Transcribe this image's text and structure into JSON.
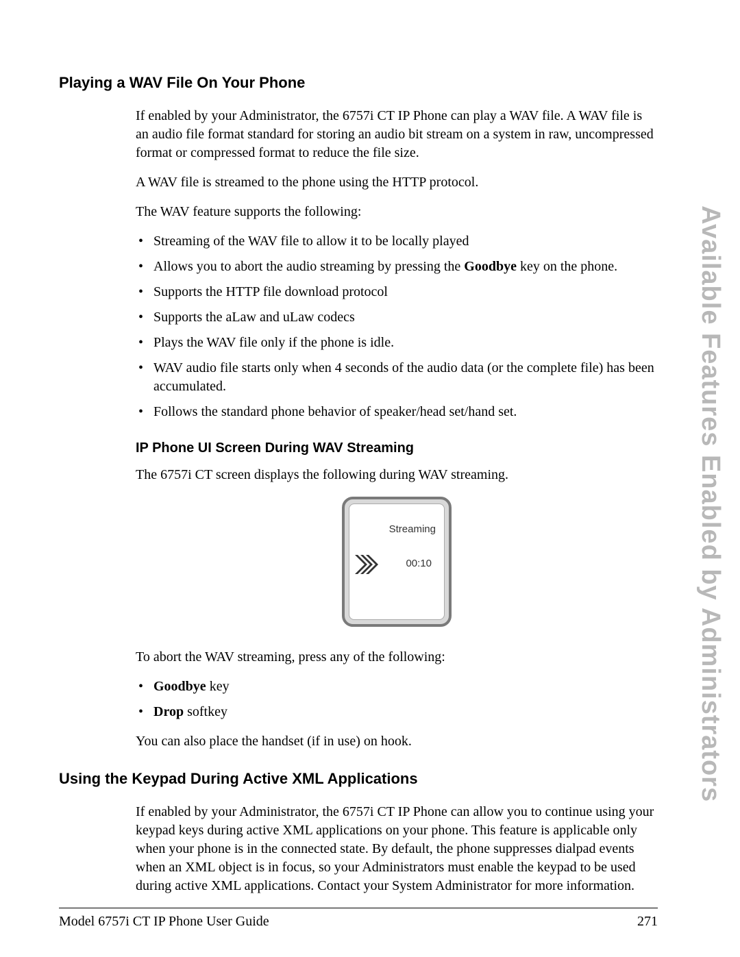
{
  "sidebar_label": "Available Features Enabled by Administrators",
  "section1": {
    "heading": "Playing a WAV File On Your Phone",
    "p1": "If enabled by your Administrator, the 6757i CT IP Phone can play a WAV file. A WAV file is an audio file format standard for storing an audio bit stream on a system in raw, uncompressed format or compressed format to reduce the file size.",
    "p2": "A WAV file is streamed to the phone using the HTTP protocol.",
    "p3": "The WAV feature supports the following:",
    "bullets": [
      "Streaming of the WAV file to allow it to be locally played",
      "Allows you to abort the audio streaming by pressing the Goodbye key on the phone.",
      "Supports the HTTP file download protocol",
      "Supports the aLaw and uLaw codecs",
      "Plays the WAV file only if the phone is idle.",
      "WAV audio file starts only when 4 seconds of the audio data (or the complete file) has been accumulated.",
      "Follows the standard phone behavior of speaker/head set/hand set."
    ],
    "sub_heading": "IP Phone UI Screen During WAV Streaming",
    "p4": "The 6757i CT screen displays the following during WAV streaming.",
    "screen": {
      "label": "Streaming",
      "time": "00:10"
    },
    "p5": "To abort the WAV streaming, press any of the following:",
    "abort_bullets_raw": [
      "Goodbye key",
      "Drop softkey"
    ],
    "abort_prefix": {
      "b1": "Goodbye",
      "b1_rest": " key",
      "b2": "Drop",
      "b2_rest": " softkey"
    },
    "p6": "You can also place the handset (if in use) on hook."
  },
  "goodbye_word": "Goodbye",
  "bullet2_part_a": "Allows you to abort the audio streaming by pressing the ",
  "bullet2_part_c": " key on the phone.",
  "section2": {
    "heading": "Using the Keypad During Active XML Applications",
    "p1": "If enabled by your Administrator, the 6757i CT IP Phone can allow you to continue using your keypad keys during active XML applications on your phone. This feature is applicable only when your phone is in the connected state. By default, the phone suppresses dialpad events when an XML object is in focus, so your Administrators must enable the keypad to be used during active XML applications. Contact your System Administrator for more information."
  },
  "footer": {
    "left": "Model 6757i CT IP Phone User Guide",
    "right": "271"
  }
}
